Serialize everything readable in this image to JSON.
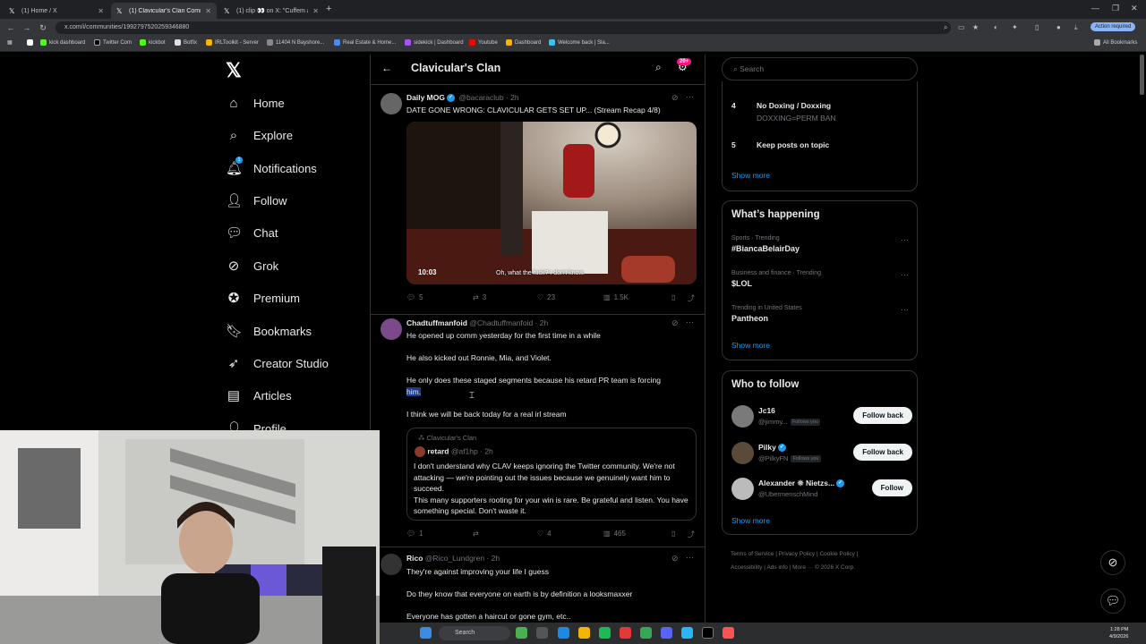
{
  "browser": {
    "tabs": [
      {
        "label": "(1) Home / X",
        "active": false
      },
      {
        "label": "(1) Clavicular's Clan Communi",
        "active": true
      },
      {
        "label": "(1) clip 👀 on X: \"Cuffem absol",
        "active": false
      }
    ],
    "url": "x.com/i/communities/1992797520259346880",
    "action_required": "Action required",
    "bookmarks": [
      "kick dashboard",
      "Twitter Com",
      "kickbot",
      "Botfix",
      "IRLToolkit - Server",
      "11404 N Bayshore...",
      "Real Estate & Home...",
      "sidekick | Dashboard",
      "Youtube",
      "Dashboard",
      "Welcome back | Sla..."
    ],
    "all_bookmarks": "All Bookmarks"
  },
  "sidebar": {
    "logo": "𝕏",
    "items": [
      {
        "label": "Home",
        "icon": "home-icon",
        "glyph": "⌂"
      },
      {
        "label": "Explore",
        "icon": "search-icon",
        "glyph": "⌕"
      },
      {
        "label": "Notifications",
        "icon": "bell-icon",
        "glyph": "🔔︎",
        "badge": "1"
      },
      {
        "label": "Follow",
        "icon": "person-add-icon",
        "glyph": "👤︎"
      },
      {
        "label": "Chat",
        "icon": "chat-icon",
        "glyph": "💬︎"
      },
      {
        "label": "Grok",
        "icon": "grok-icon",
        "glyph": "⊘"
      },
      {
        "label": "Premium",
        "icon": "premium-icon",
        "glyph": "✪"
      },
      {
        "label": "Bookmarks",
        "icon": "bookmark-icon",
        "glyph": "🔖︎"
      },
      {
        "label": "Creator Studio",
        "icon": "rocket-icon",
        "glyph": "➶"
      },
      {
        "label": "Articles",
        "icon": "article-icon",
        "glyph": "▤"
      },
      {
        "label": "Profile",
        "icon": "profile-icon",
        "glyph": "👤︎"
      }
    ]
  },
  "header": {
    "title": "Clavicular's Clan",
    "badge": "20+"
  },
  "posts": [
    {
      "name": "Daily MOG",
      "handle": "@bacaraclub",
      "time": "· 2h",
      "text": "DATE GONE WRONG: CLAVICULAR GETS SET UP... (Stream Recap 4/8)",
      "video_duration": "10:03",
      "caption": "Oh, what the fuck? I don't know.",
      "replies": "5",
      "reposts": "3",
      "likes": "23",
      "views": "1.5K"
    },
    {
      "name": "Chadtuffmanfoid",
      "handle": "@Chadtuffmanfoid",
      "time": "· 2h",
      "lines": [
        "He opened up comm yesterday for the first time in a while",
        "He also kicked out Ronnie, Mia, and Violet.",
        "He only does these staged segments because his retard PR team is forcing",
        "him.",
        "I think we will be back today for a real irl stream"
      ],
      "quote": {
        "community": "Clavicular's Clan",
        "name": "retard",
        "handle": "@af1hp",
        "time": "· 2h",
        "text": "I don't understand why CLAV keeps ignoring the Twitter community. We're not attacking — we're pointing out the issues because we genuinely want him to succeed.\nThis many supporters rooting for your win is rare. Be grateful and listen. You have something special. Don't waste it."
      },
      "replies": "1",
      "reposts": "",
      "likes": "4",
      "views": "465"
    },
    {
      "name": "Rico",
      "handle": "@Rico_Lundgren",
      "time": "· 2h",
      "lines": [
        "They're against improving your life I guess",
        "Do they know that everyone on earth is by definition a looksmaxxer",
        "Everyone has gotten a haircut or gone gym, etc.."
      ]
    }
  ],
  "right": {
    "search_placeholder": "Search",
    "rules": [
      {
        "num": "4",
        "title": "No Doxing / Doxxing",
        "sub": "DOXXING=PERM BAN"
      },
      {
        "num": "5",
        "title": "Keep posts on topic",
        "sub": ""
      }
    ],
    "show_more": "Show more",
    "happening_title": "What’s happening",
    "trends": [
      {
        "meta": "Sports · Trending",
        "tag": "#BiancaBelairDay"
      },
      {
        "meta": "Business and finance · Trending",
        "tag": "$LOL"
      },
      {
        "meta": "Trending in United States",
        "tag": "Pantheon"
      }
    ],
    "wtf_title": "Who to follow",
    "who_to_follow": [
      {
        "name": "Jc16",
        "handle": "@jimmy...",
        "follows_you": "Follows you",
        "button": "Follow back",
        "verified": false
      },
      {
        "name": "Pilky",
        "handle": "@PilkyFN",
        "follows_you": "Follows you",
        "button": "Follow back",
        "verified": true
      },
      {
        "name": "Alexander ❊ Nietzs...",
        "handle": "@UbermenschMind",
        "follows_you": "",
        "button": "Follow",
        "verified": true
      }
    ],
    "footer": {
      "line1": "Terms of Service  |  Privacy Policy  |  Cookie Policy  |",
      "line2": "Accessibility  |  Ads info  |  More ···  © 2026 X Corp."
    }
  },
  "taskbar": {
    "search": "Search",
    "time": "1:28 PM",
    "date": "4/9/2026"
  }
}
